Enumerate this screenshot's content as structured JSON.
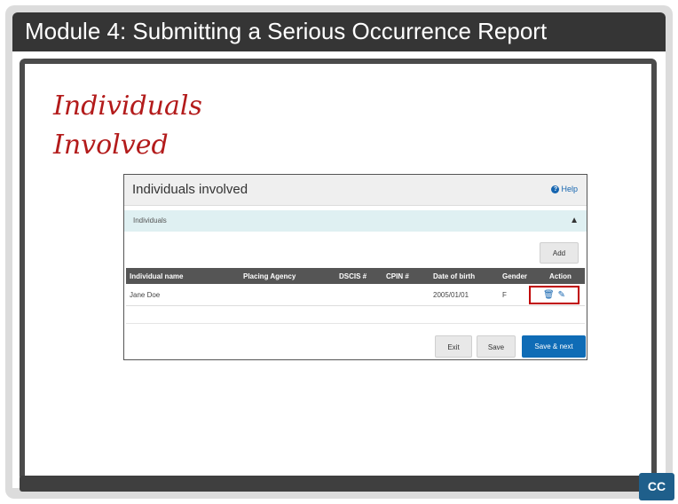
{
  "header": {
    "title": "Module 4:  Submitting a Serious Occurrence Report"
  },
  "slide": {
    "heading_line1": "Individuals",
    "heading_line2": "Involved"
  },
  "card": {
    "title": "Individuals involved",
    "help_label": "Help",
    "section_label": "Individuals",
    "add_label": "Add",
    "columns": [
      "Individual name",
      "Placing Agency",
      "DSCIS #",
      "CPIN #",
      "Date of birth",
      "Gender",
      "Action"
    ],
    "rows": [
      {
        "name": "Jane Doe",
        "agency": "",
        "dscis": "",
        "cpin": "",
        "dob": "2005/01/01",
        "gender": "F"
      }
    ],
    "buttons": {
      "exit": "Exit",
      "save": "Save",
      "save_next": "Save & next"
    }
  },
  "cc_label": "CC",
  "icons": {
    "help": "help-circle-icon",
    "collapse": "chevron-up-icon",
    "delete": "trash-icon",
    "edit": "pencil-icon"
  },
  "colors": {
    "heading": "#b31b1b",
    "primary_button": "#0f6cb6",
    "highlight_box": "#c00000"
  }
}
